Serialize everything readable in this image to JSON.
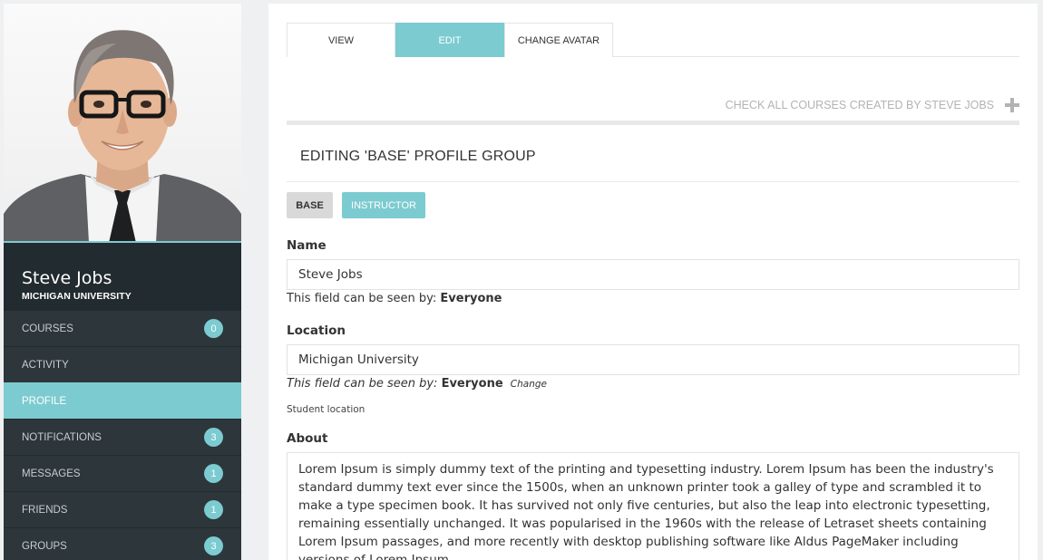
{
  "profile": {
    "name": "Steve Jobs",
    "organization": "MICHIGAN UNIVERSITY"
  },
  "sidebar": {
    "items": [
      {
        "label": "COURSES",
        "badge": "0"
      },
      {
        "label": "ACTIVITY",
        "badge": ""
      },
      {
        "label": "PROFILE",
        "badge": ""
      },
      {
        "label": "NOTIFICATIONS",
        "badge": "3"
      },
      {
        "label": "MESSAGES",
        "badge": "1"
      },
      {
        "label": "FRIENDS",
        "badge": "1"
      },
      {
        "label": "GROUPS",
        "badge": "3"
      }
    ],
    "active": "PROFILE"
  },
  "tabs": {
    "view": "VIEW",
    "edit": "EDIT",
    "change_avatar": "CHANGE AVATAR",
    "active": "EDIT"
  },
  "check_courses_link": "CHECK ALL COURSES CREATED BY STEVE JOBS",
  "section_title": "EDITING 'BASE' PROFILE GROUP",
  "groups": {
    "base": "BASE",
    "instructor": "INSTRUCTOR"
  },
  "fields": {
    "name": {
      "label": "Name",
      "value": "Steve Jobs",
      "visibility_prefix": "This field can be seen by:",
      "visibility_value": "Everyone"
    },
    "location": {
      "label": "Location",
      "value": "Michigan University",
      "visibility_prefix": "This field can be seen by:",
      "visibility_value": "Everyone",
      "change_label": "Change",
      "description": "Student location"
    },
    "about": {
      "label": "About",
      "value": "Lorem Ipsum is simply dummy text of the printing and typesetting industry. Lorem Ipsum has been the industry's standard dummy text ever since the 1500s, when an unknown printer took a galley of type and scrambled it to make a type specimen book. It has survived not only five centuries, but also the leap into electronic typesetting, remaining essentially unchanged. It was popularised in the 1960s with the release of Letraset sheets containing Lorem Ipsum passages, and more recently with desktop publishing software like Aldus PageMaker including versions of Lorem Ipsum."
    }
  },
  "colors": {
    "accent": "#7ccbd0",
    "sidebar_bg": "#2d363b",
    "sidebar_header_bg": "#222b2f",
    "page_bg": "#eef0f1"
  },
  "icons": {
    "plus": "plus-icon",
    "resize": "resize-handle-icon",
    "avatar": "avatar-photo"
  }
}
